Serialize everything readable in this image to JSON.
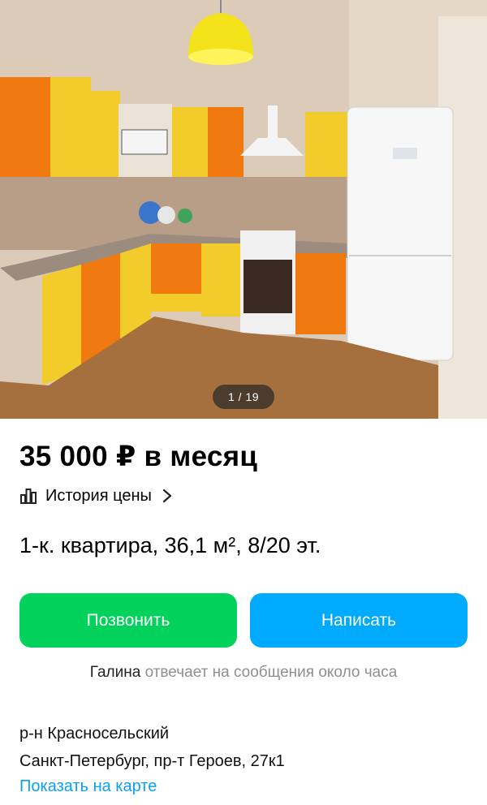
{
  "gallery": {
    "counter": "1 / 19"
  },
  "listing": {
    "price": "35 000 ₽ в месяц",
    "price_history_label": "История цены",
    "title": "1-к. квартира, 36,1 м², 8/20 эт."
  },
  "actions": {
    "call_label": "Позвонить",
    "write_label": "Написать",
    "call_color": "#02d15c",
    "write_color": "#00aaff"
  },
  "seller": {
    "name": "Галина",
    "response_text": "отвечает на сообщения около часа"
  },
  "location": {
    "district": "р-н Красносельский",
    "address": "Санкт-Петербург, пр-т Героев, 27к1",
    "map_link_label": "Показать на карте"
  },
  "icons": {
    "price_history": "bar-chart-icon",
    "chevron": "chevron-right-icon"
  }
}
